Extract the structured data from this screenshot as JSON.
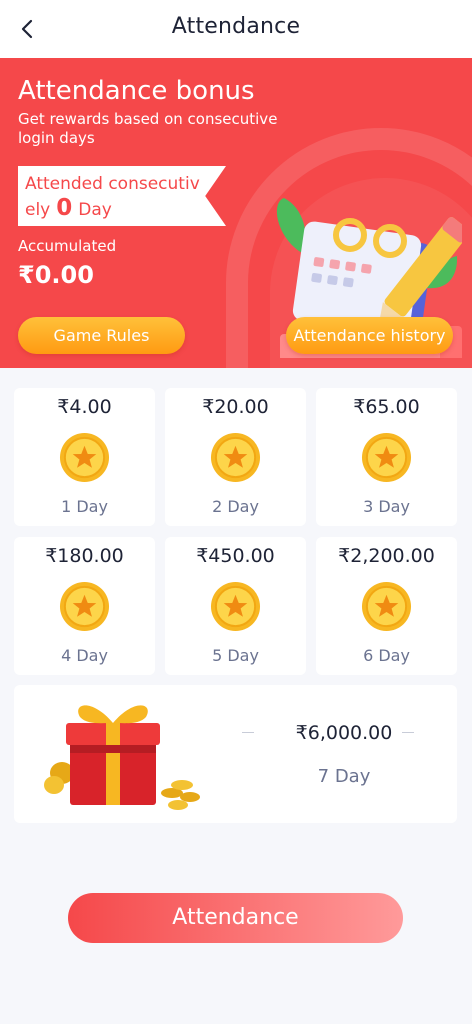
{
  "header": {
    "title": "Attendance",
    "back_icon": "chevron-left-icon"
  },
  "banner": {
    "title": "Attendance bonus",
    "subtitle": "Get rewards based on consecutive login days",
    "streak_prefix": "Attended consecutively",
    "streak_days": "0",
    "streak_suffix": "Day",
    "accumulated_label": "Accumulated",
    "accumulated_value": "₹0.00",
    "game_rules_label": "Game Rules",
    "history_label": "Attendance history",
    "background_color": "#f5484a",
    "button_color": "#ffa820"
  },
  "rewards": [
    {
      "amount": "₹4.00",
      "day": "1 Day"
    },
    {
      "amount": "₹20.00",
      "day": "2 Day"
    },
    {
      "amount": "₹65.00",
      "day": "3 Day"
    },
    {
      "amount": "₹180.00",
      "day": "4 Day"
    },
    {
      "amount": "₹450.00",
      "day": "5 Day"
    },
    {
      "amount": "₹2,200.00",
      "day": "6 Day"
    }
  ],
  "final_reward": {
    "amount": "₹6,000.00",
    "day": "7 Day"
  },
  "attendance_button": "Attendance"
}
